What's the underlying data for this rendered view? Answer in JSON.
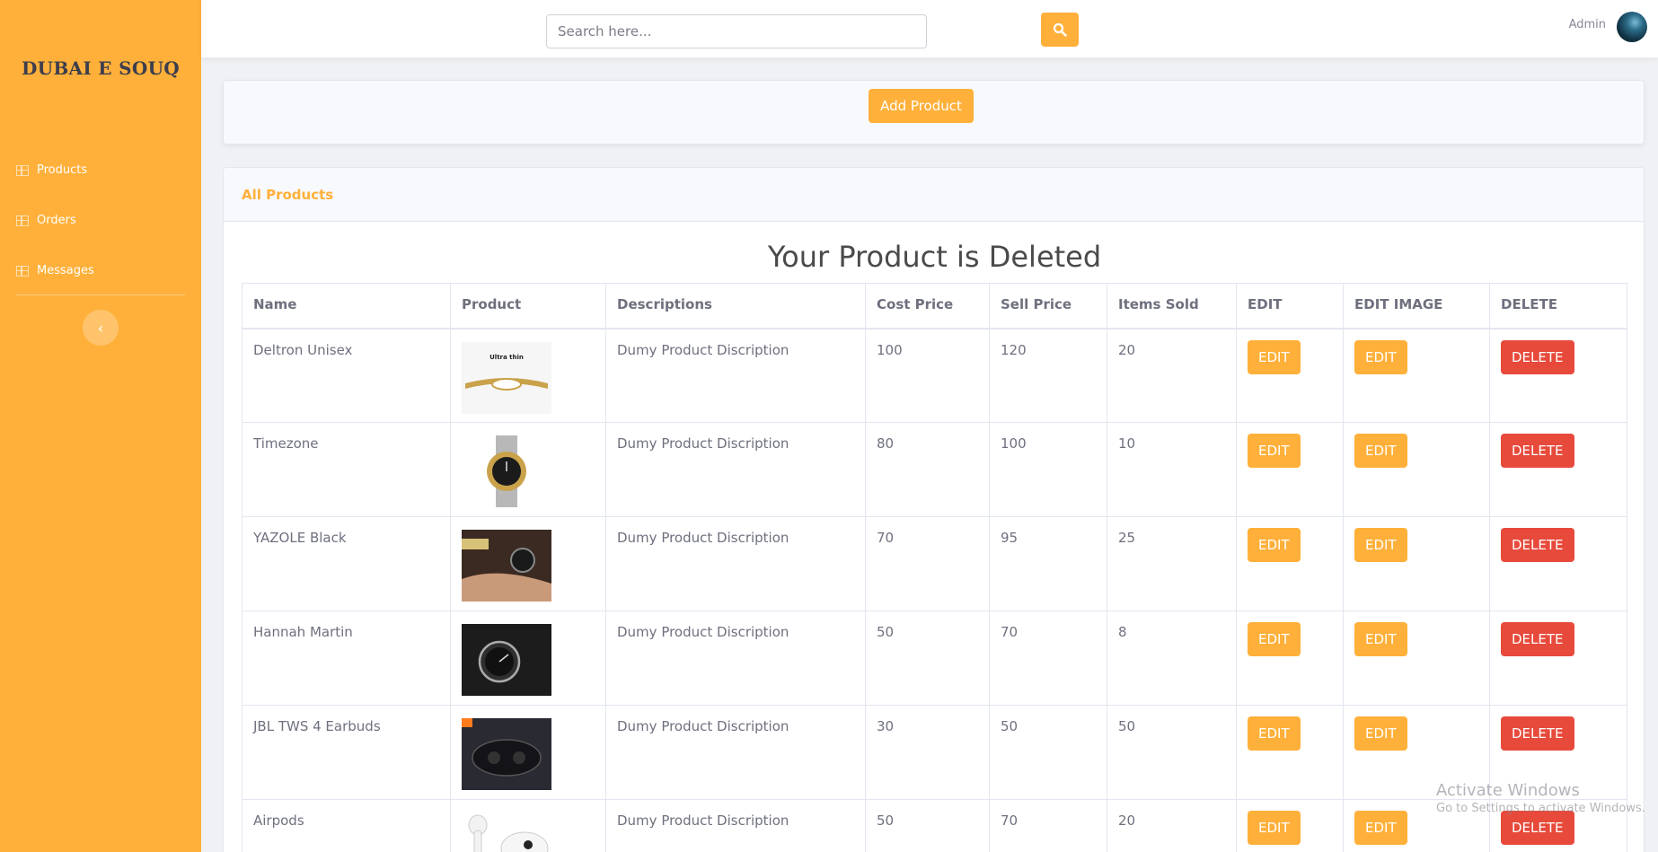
{
  "brand": "DUBAI E SOUQ",
  "sidebar": {
    "items": [
      {
        "label": "Products",
        "icon": "table-icon"
      },
      {
        "label": "Orders",
        "icon": "table-icon"
      },
      {
        "label": "Messages",
        "icon": "table-icon"
      }
    ],
    "toggle": "‹"
  },
  "topbar": {
    "search_placeholder": "Search here...",
    "user": "Admin"
  },
  "actions": {
    "add_product": "Add Product"
  },
  "products_card": {
    "title": "All Products",
    "message": "Your Product is Deleted"
  },
  "table": {
    "headers": [
      "Name",
      "Product",
      "Descriptions",
      "Cost Price",
      "Sell Price",
      "Items Sold",
      "EDIT",
      "EDIT IMAGE",
      "DELETE"
    ],
    "rows": [
      {
        "name": "Deltron Unisex",
        "image_label": "Ultra thin",
        "description": "Dumy Product Discription",
        "cost": "100",
        "sell": "120",
        "sold": "20"
      },
      {
        "name": "Timezone",
        "image_label": "",
        "description": "Dumy Product Discription",
        "cost": "80",
        "sell": "100",
        "sold": "10"
      },
      {
        "name": "YAZOLE Black",
        "image_label": "",
        "description": "Dumy Product Discription",
        "cost": "70",
        "sell": "95",
        "sold": "25"
      },
      {
        "name": "Hannah Martin",
        "image_label": "",
        "description": "Dumy Product Discription",
        "cost": "50",
        "sell": "70",
        "sold": "8"
      },
      {
        "name": "JBL TWS 4 Earbuds",
        "image_label": "",
        "description": "Dumy Product Discription",
        "cost": "30",
        "sell": "50",
        "sold": "50"
      },
      {
        "name": "Airpods",
        "image_label": "",
        "description": "Dumy Product Discription",
        "cost": "50",
        "sell": "70",
        "sold": "20"
      }
    ],
    "edit_label": "EDIT",
    "delete_label": "DELETE"
  },
  "watermark": {
    "title": "Activate Windows",
    "subtitle": "Go to Settings to activate Windows."
  },
  "colors": {
    "accent": "#ffb03a",
    "danger": "#e74a3b"
  }
}
